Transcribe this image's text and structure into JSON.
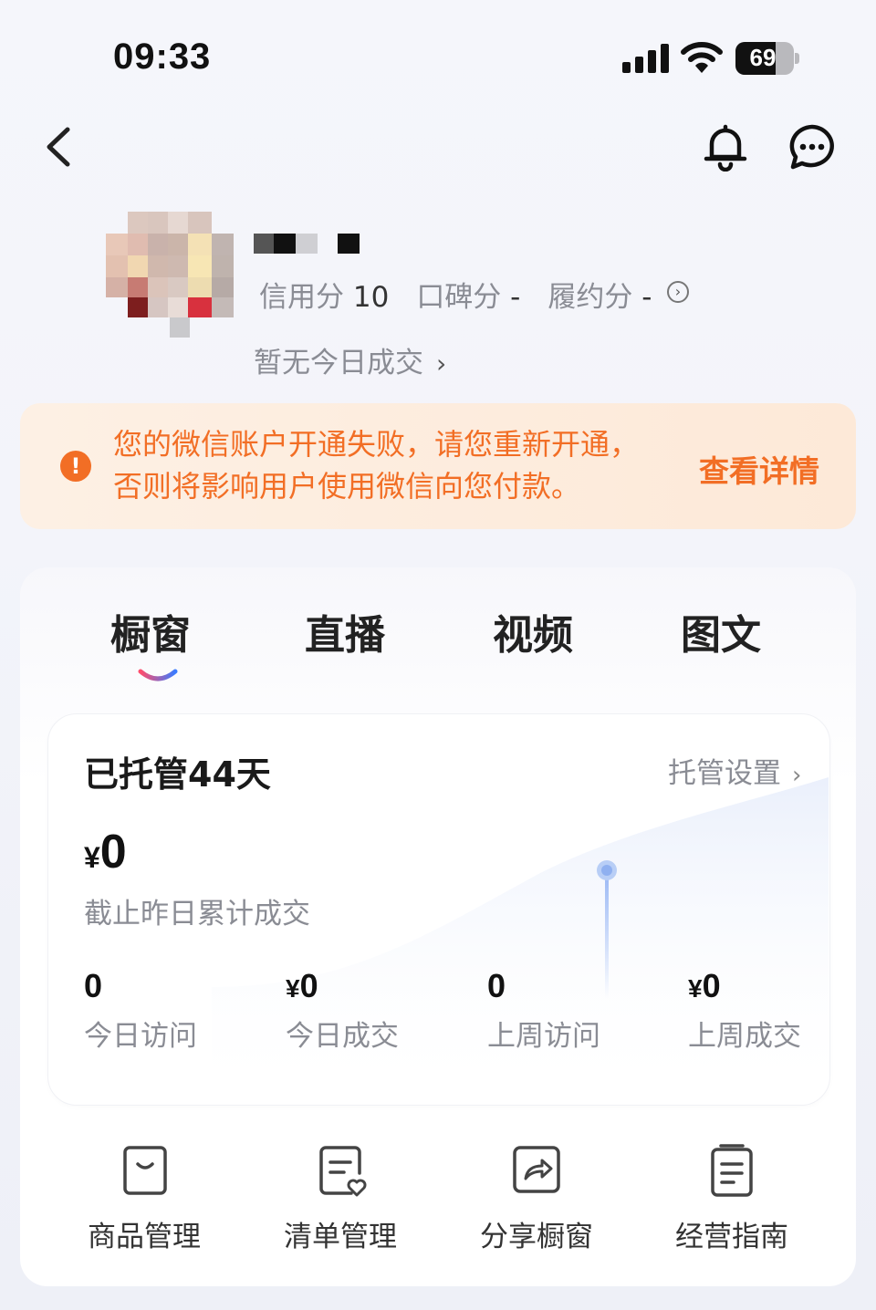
{
  "status_bar": {
    "time": "09:33",
    "battery": "69"
  },
  "profile": {
    "scores": [
      {
        "label": "信用分",
        "value": "10"
      },
      {
        "label": "口碑分",
        "value": "-"
      },
      {
        "label": "履约分",
        "value": "-"
      }
    ],
    "today_deal": "暂无今日成交"
  },
  "alert": {
    "icon": "!",
    "message": "您的微信账户开通失败，请您重新开通，否则将影响用户使用微信向您付款。",
    "action": "查看详情",
    "color": "#f26e25"
  },
  "tabs": [
    {
      "label": "橱窗",
      "active": true
    },
    {
      "label": "直播",
      "active": false
    },
    {
      "label": "视频",
      "active": false
    },
    {
      "label": "图文",
      "active": false
    }
  ],
  "managed": {
    "title": "已托管44天",
    "settings": "托管设置",
    "cumulative_currency": "¥",
    "cumulative_value": "0",
    "cumulative_label": "截止昨日累计成交"
  },
  "stats": [
    {
      "currency": "",
      "value": "0",
      "label": "今日访问"
    },
    {
      "currency": "¥",
      "value": "0",
      "label": "今日成交"
    },
    {
      "currency": "",
      "value": "0",
      "label": "上周访问"
    },
    {
      "currency": "¥",
      "value": "0",
      "label": "上周成交"
    }
  ],
  "tools": [
    {
      "label": "商品管理",
      "icon": "bag-icon"
    },
    {
      "label": "清单管理",
      "icon": "list-heart-icon"
    },
    {
      "label": "分享橱窗",
      "icon": "share-icon"
    },
    {
      "label": "经营指南",
      "icon": "guide-icon"
    }
  ]
}
